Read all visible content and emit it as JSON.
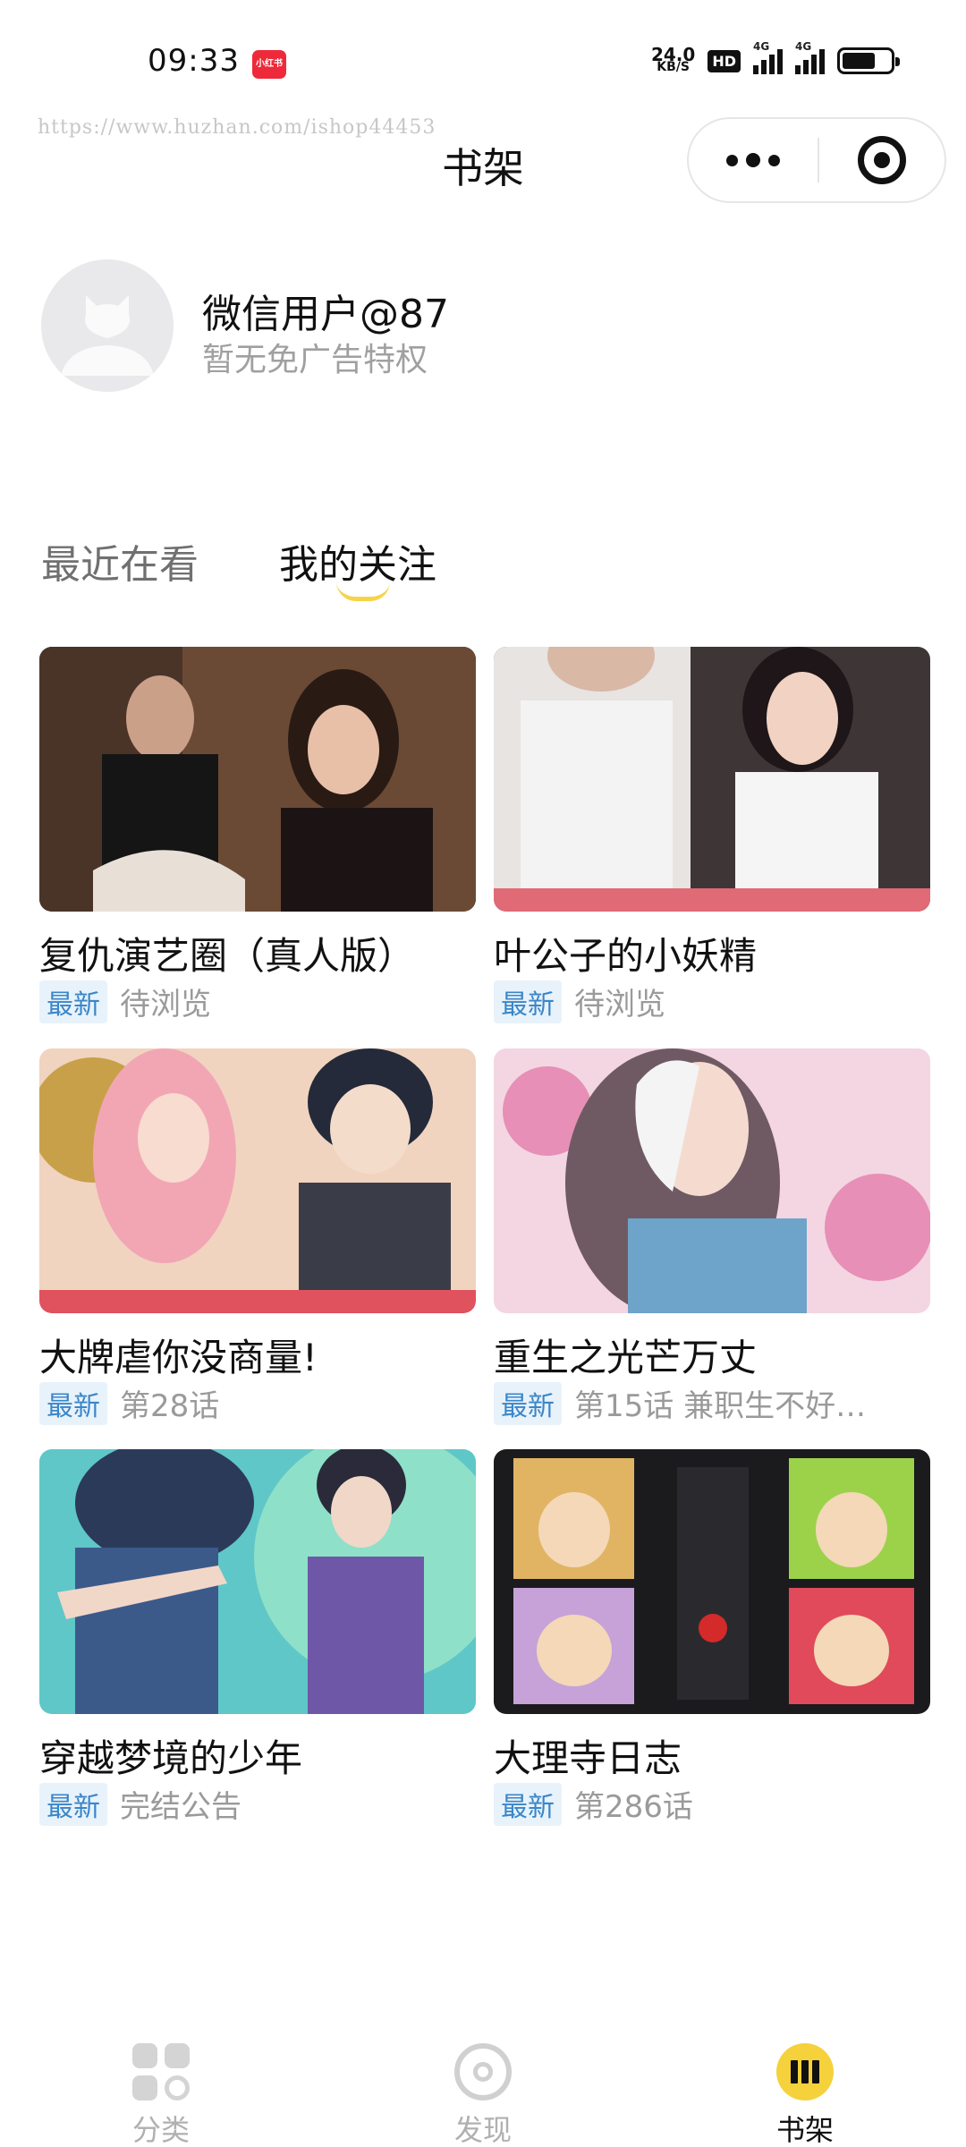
{
  "status_bar": {
    "time": "09:33",
    "app_badge": "小红书",
    "net_speed_value": "24.0",
    "net_speed_unit": "KB/S",
    "hd_label": "HD",
    "signal_1_label": "4G",
    "signal_2_label": "4G",
    "battery_level": 0.7
  },
  "header": {
    "watermark": "https://www.huzhan.com/ishop44453",
    "title": "书架",
    "more_icon": "more-dots-icon",
    "target_icon": "target-icon"
  },
  "profile": {
    "username": "微信用户@87",
    "subtitle": "暂无免广告特权"
  },
  "tabs": [
    {
      "label": "最近在看",
      "active": false
    },
    {
      "label": "我的关注",
      "active": true
    }
  ],
  "books": [
    {
      "title": "复仇演艺圈（真人版）",
      "tag": "最新",
      "status": "待浏览"
    },
    {
      "title": "叶公子的小妖精",
      "tag": "最新",
      "status": "待浏览"
    },
    {
      "title": "大牌虐你没商量!",
      "tag": "最新",
      "status": "第28话"
    },
    {
      "title": "重生之光芒万丈",
      "tag": "最新",
      "status": "第15话 兼职生不好…"
    },
    {
      "title": "穿越梦境的少年",
      "tag": "最新",
      "status": "完结公告"
    },
    {
      "title": "大理寺日志",
      "tag": "最新",
      "status": "第286话"
    }
  ],
  "bottom_nav": [
    {
      "label": "分类",
      "icon": "category-grid-icon",
      "active": false
    },
    {
      "label": "发现",
      "icon": "discover-icon",
      "active": false
    },
    {
      "label": "书架",
      "icon": "bookshelf-icon",
      "active": true
    }
  ],
  "colors": {
    "accent": "#f5d13b",
    "tag_bg": "#e8f2fb",
    "tag_text": "#3a86c8"
  }
}
